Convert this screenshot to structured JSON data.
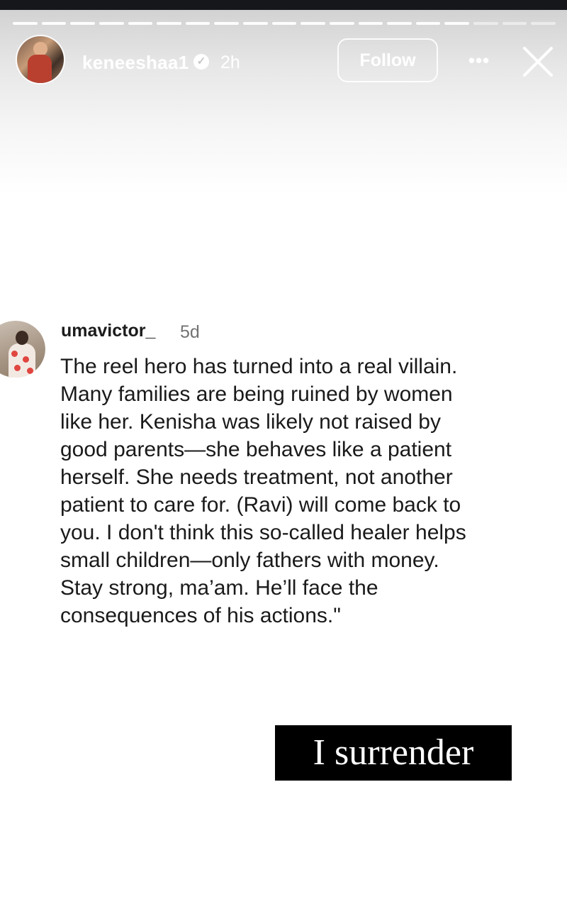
{
  "story": {
    "progress": {
      "segments": 19,
      "completed": 16
    },
    "header": {
      "username": "keneeshaa1",
      "verified_icon": "verified-check-icon",
      "time": "2h",
      "follow_label": "Follow",
      "more_label": "•••"
    }
  },
  "comment": {
    "username": "umavictor_",
    "time": "5d",
    "lines": [
      "The reel hero has turned into a real villain.",
      "Many families are being ruined by women",
      "like her. Kenisha was likely not raised by",
      "good parents—she behaves like a patient",
      "herself. She needs treatment, not another",
      "patient to care for. (Ravi) will come back to",
      "you. I don't think this so-called healer helps",
      "small children—only fathers with money.",
      "Stay strong, ma’am. He’ll face the",
      "consequences of his actions.\""
    ]
  },
  "sticker": {
    "text": "I surrender"
  }
}
